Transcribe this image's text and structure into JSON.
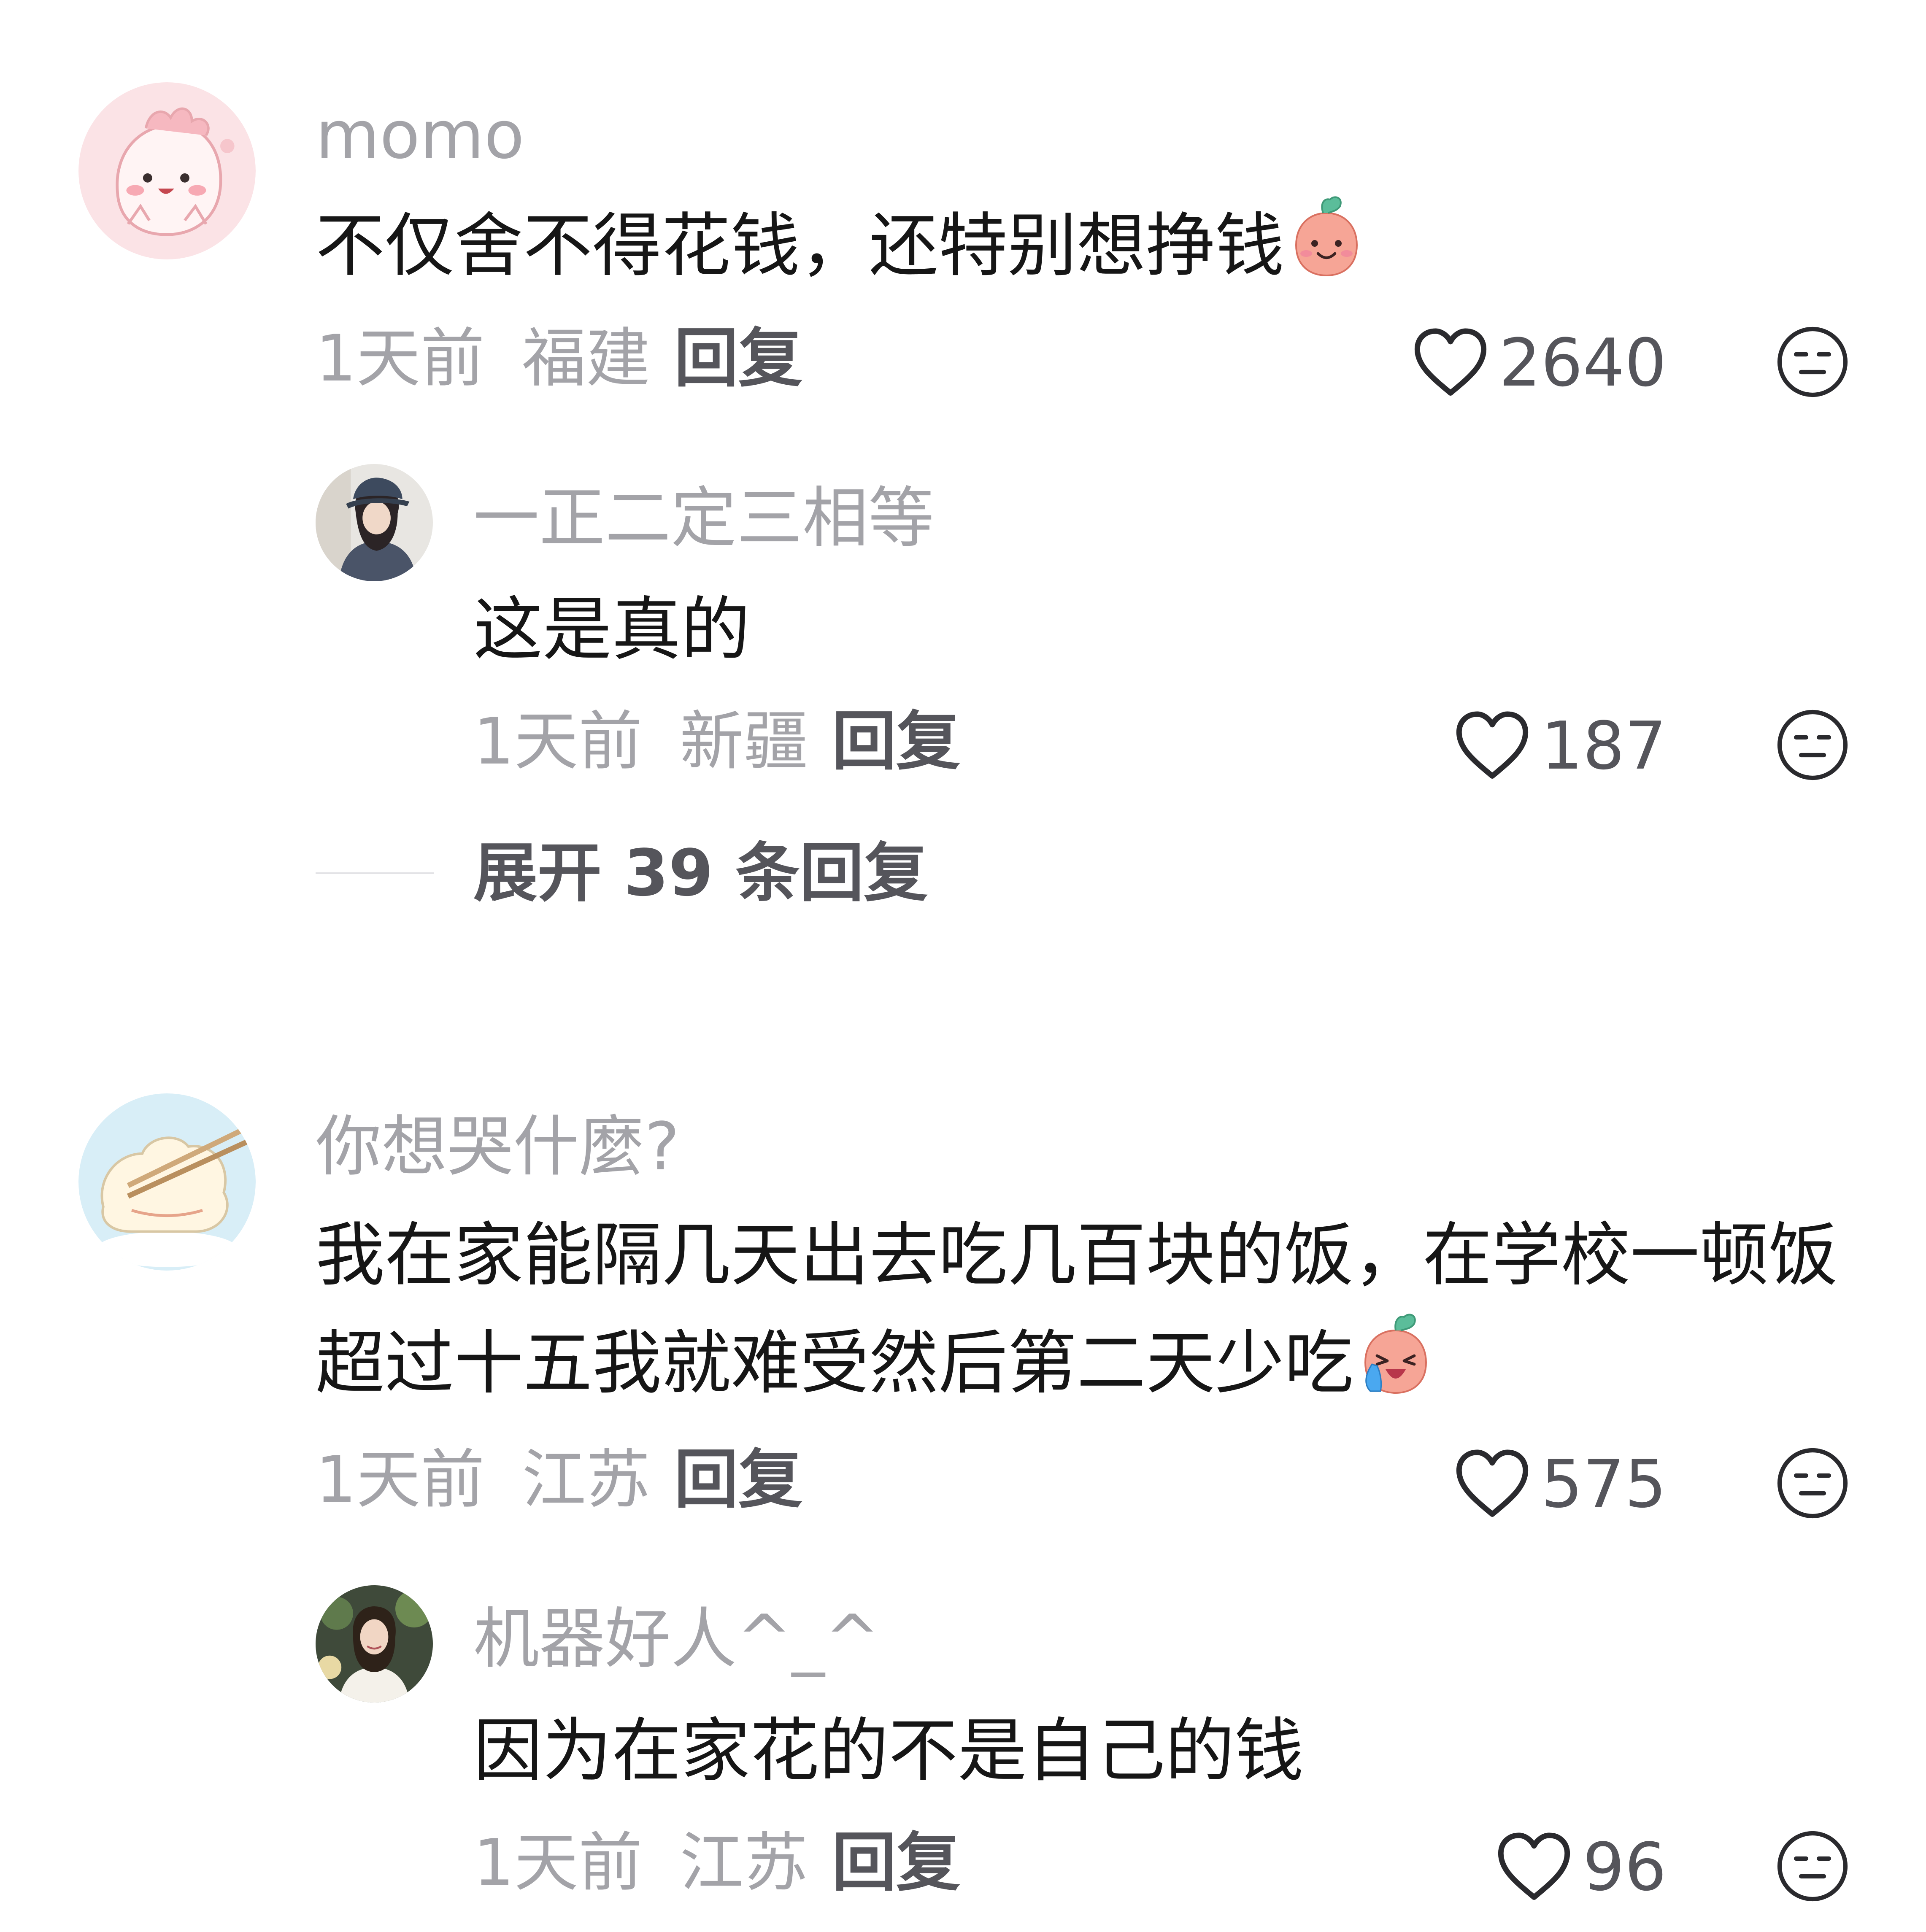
{
  "comments": [
    {
      "username": "momo",
      "text_lines": [
        "不仅舍不得花钱，还特别想挣钱"
      ],
      "emoji": "smiling-peach-emoji",
      "time": "1天前",
      "location": "福建",
      "reply_label": "回复",
      "likes": "2640",
      "replies": [
        {
          "username": "一正二定三相等",
          "text": "这是真的",
          "time": "1天前",
          "location": "新疆",
          "reply_label": "回复",
          "likes": "187"
        }
      ],
      "expand_label": "展开 39 条回复"
    },
    {
      "username": "你想哭什麼?",
      "text_lines": [
        "我在家能隔几天出去吃几百块的饭，在学校一顿饭",
        "超过十五我就难受然后第二天少吃"
      ],
      "emoji": "crying-peach-emoji",
      "time": "1天前",
      "location": "江苏",
      "reply_label": "回复",
      "likes": "575",
      "replies": [
        {
          "username": "机器好人^_^",
          "text": "因为在家花的不是自己的钱",
          "time": "1天前",
          "location": "江苏",
          "reply_label": "回复",
          "likes": "96"
        }
      ]
    }
  ],
  "colors": {
    "text_primary": "#161616",
    "text_secondary": "#a3a3a8",
    "text_action": "#55555b",
    "divider": "#e3e3e6"
  }
}
